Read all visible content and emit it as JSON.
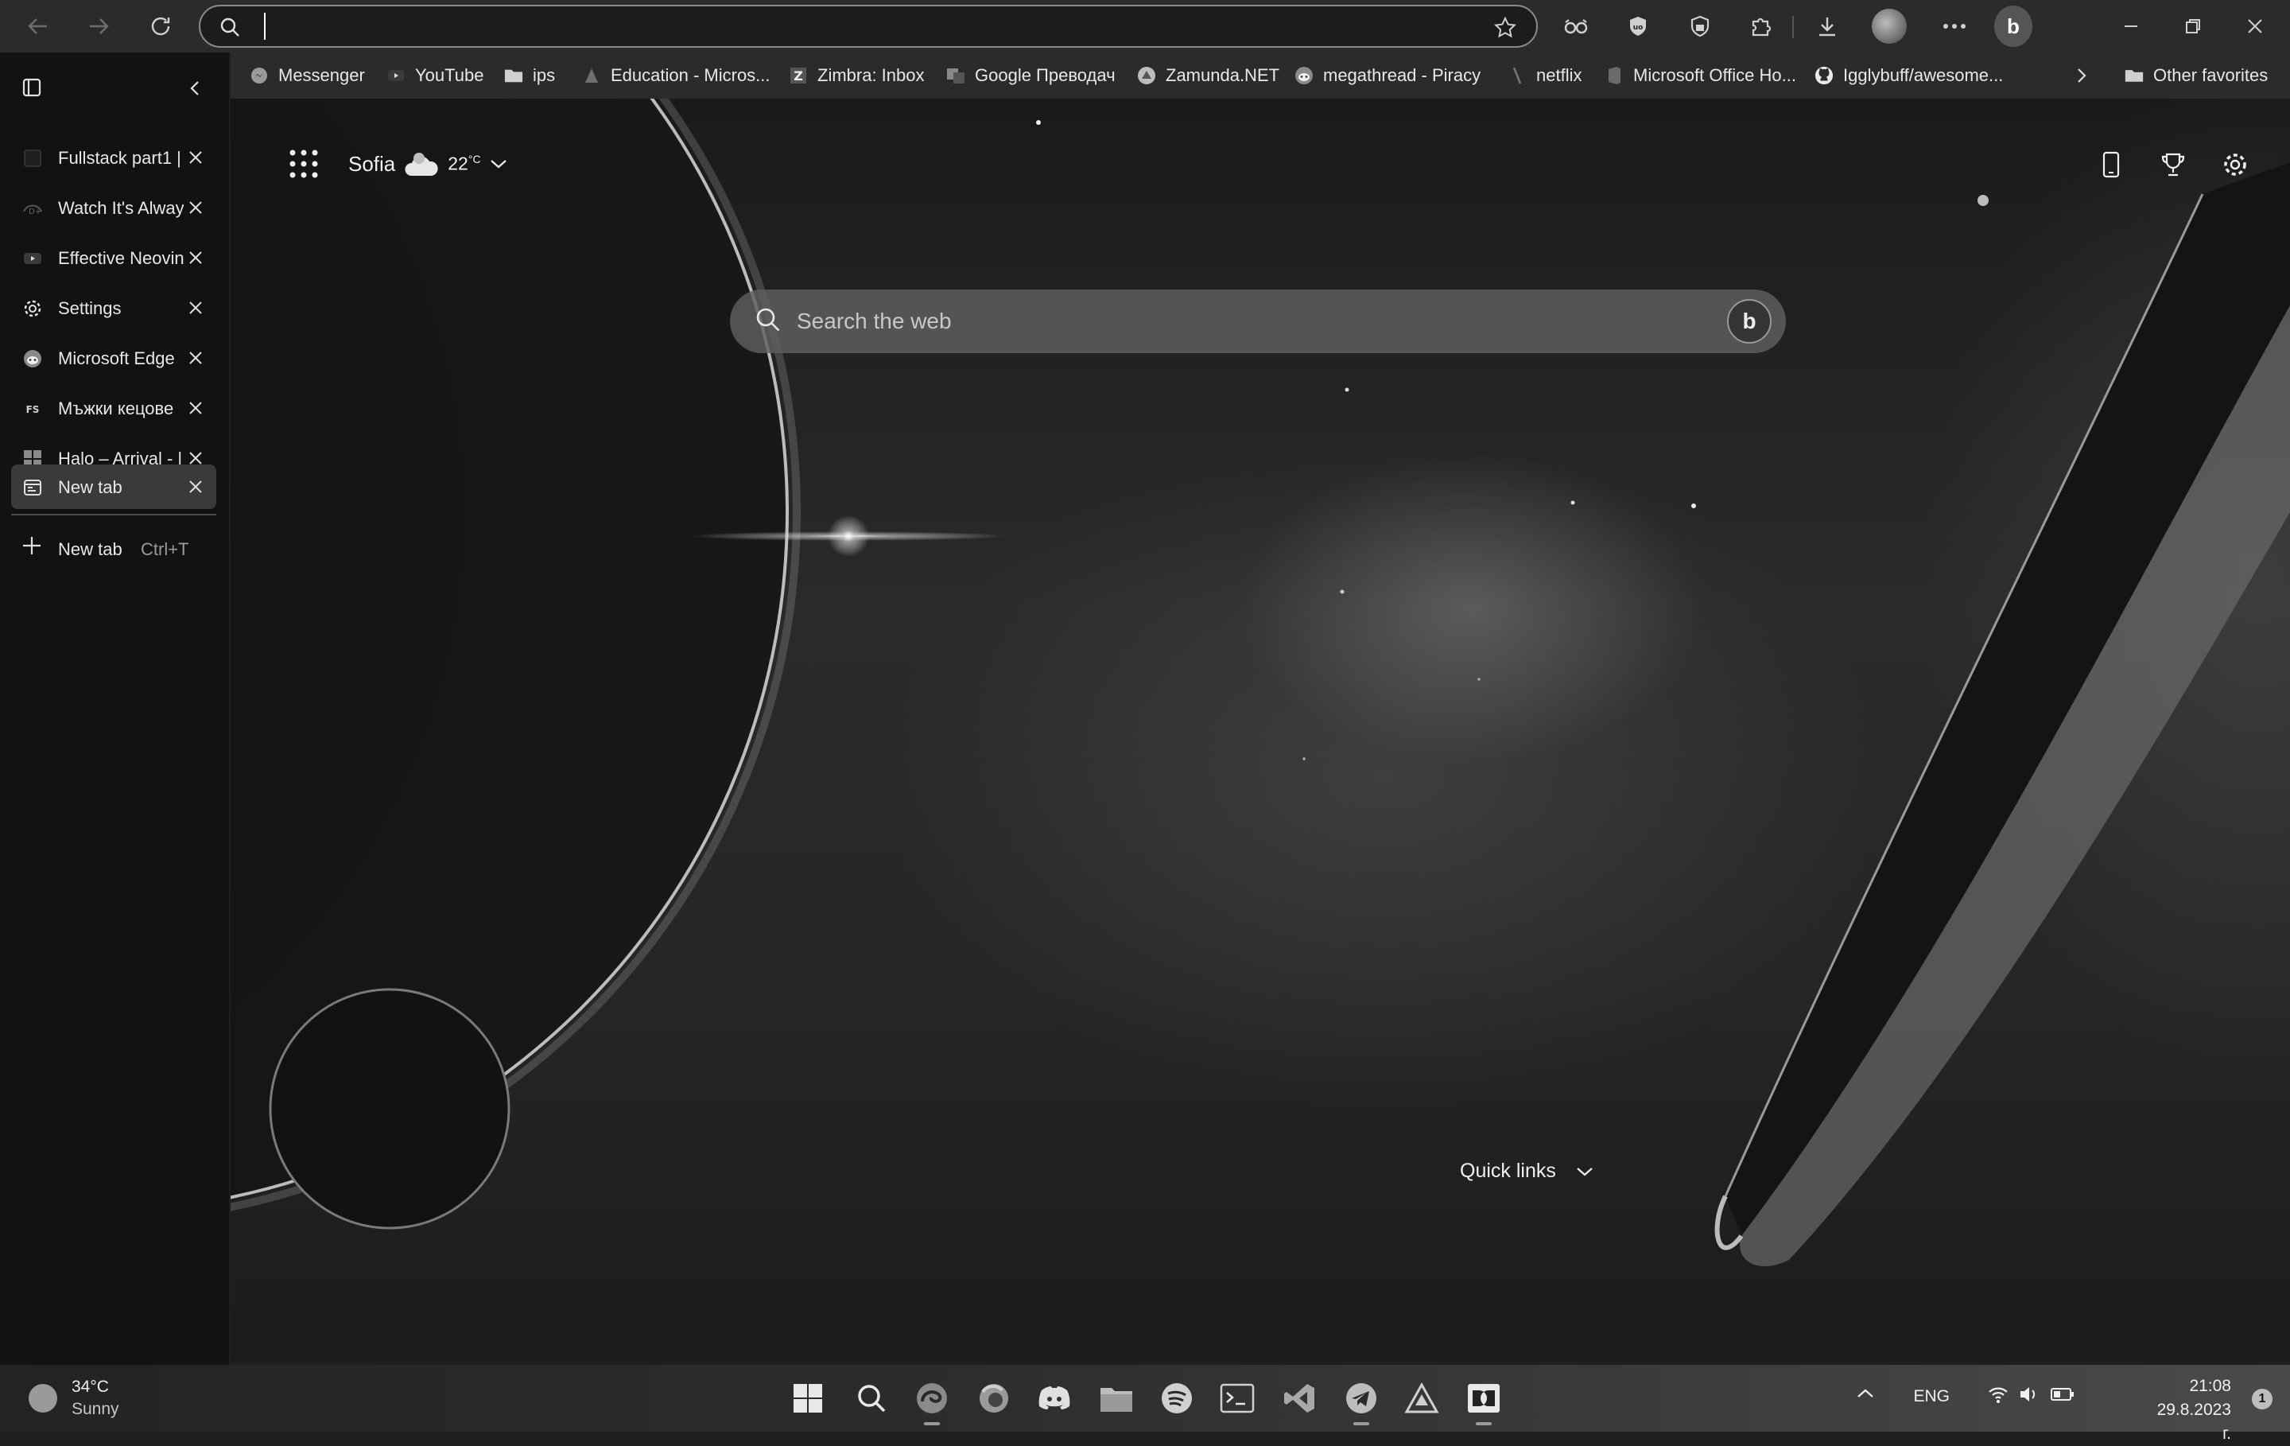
{
  "browser": {
    "address_value": "",
    "address_placeholder": ""
  },
  "favorites": [
    {
      "label": "Messenger",
      "icon": "messenger-icon"
    },
    {
      "label": "YouTube",
      "icon": "youtube-icon"
    },
    {
      "label": "ips",
      "icon": "folder-icon"
    },
    {
      "label": "Education - Micros...",
      "icon": "education-icon"
    },
    {
      "label": "Zimbra: Inbox",
      "icon": "zimbra-icon"
    },
    {
      "label": "Google Преводач",
      "icon": "translate-icon"
    },
    {
      "label": "Zamunda.NET",
      "icon": "zamunda-icon"
    },
    {
      "label": "megathread - Piracy",
      "icon": "reddit-icon"
    },
    {
      "label": "netflix",
      "icon": "netflix-icon"
    },
    {
      "label": "Microsoft Office Ho...",
      "icon": "office-icon"
    },
    {
      "label": "Igglybuff/awesome...",
      "icon": "github-icon"
    }
  ],
  "other_favorites": "Other favorites",
  "tabs": [
    {
      "label": "Fullstack part1 |",
      "icon": "page-icon"
    },
    {
      "label": "Watch It's Alway",
      "icon": "disney-icon"
    },
    {
      "label": "Effective Neovin",
      "icon": "youtube-icon"
    },
    {
      "label": "Settings",
      "icon": "gear-icon"
    },
    {
      "label": "Microsoft Edge",
      "icon": "reddit-icon"
    },
    {
      "label": "Мъжки кецове",
      "icon": "fs-icon"
    },
    {
      "label": "Halo – Arrival - |",
      "icon": "windows-icon"
    },
    {
      "label": "New tab",
      "icon": "newtab-icon",
      "active": true
    }
  ],
  "new_tab": {
    "label": "New tab",
    "shortcut": "Ctrl+T"
  },
  "newtab_page": {
    "city": "Sofia",
    "temperature": "22",
    "temp_unit": "°C",
    "search_placeholder": "Search the web",
    "quick_links": "Quick links"
  },
  "taskbar": {
    "weather_temp": "34°C",
    "weather_desc": "Sunny",
    "language": "ENG",
    "time": "21:08",
    "date": "29.8.2023 г.",
    "notifications": "1"
  }
}
